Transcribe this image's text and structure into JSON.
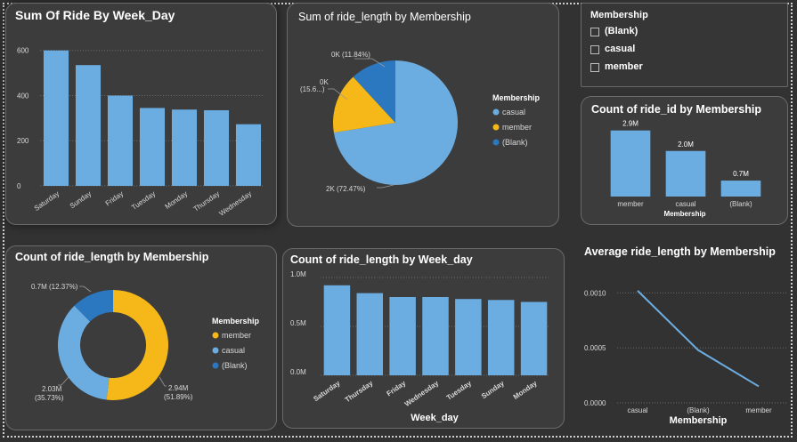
{
  "colors": {
    "background": "#323232",
    "card": "#3c3c3c",
    "light_blue": "#6cade1",
    "yellow": "#f6b818",
    "dark_blue": "#2b77c0",
    "grid": "#6a6a6a",
    "axis_text": "#d8d8d8"
  },
  "slicer": {
    "title": "Membership",
    "options": [
      "(Blank)",
      "casual",
      "member"
    ]
  },
  "chart_data": [
    {
      "id": "week_day_sum",
      "type": "bar",
      "title": "Sum Of Ride By Week_Day",
      "categories": [
        "Saturday",
        "Sunday",
        "Friday",
        "Tuesday",
        "Monday",
        "Thursday",
        "Wednesday"
      ],
      "values": [
        600,
        535,
        400,
        345,
        338,
        335,
        273
      ],
      "yticks": [
        "0",
        "200",
        "400",
        "600"
      ],
      "ytick_values": [
        0,
        200,
        400,
        600
      ],
      "ylim": [
        0,
        650
      ],
      "grid": true
    },
    {
      "id": "ride_length_sum_pie",
      "type": "pie",
      "title": "Sum of ride_length by Membership",
      "legend_title": "Membership",
      "legend_position": "right",
      "slices": [
        {
          "name": "casual",
          "value": 72.47,
          "label": "2K (72.47%)",
          "color": "#6cade1"
        },
        {
          "name": "member",
          "value": 15.69,
          "label": "0K (15.6...)",
          "color": "#f6b818"
        },
        {
          "name": "(Blank)",
          "value": 11.84,
          "label": "0K (11.84%)",
          "color": "#2b77c0"
        }
      ]
    },
    {
      "id": "ride_id_count",
      "type": "bar",
      "title": "Count of ride_id by Membership",
      "xlabel": "Membership",
      "categories": [
        "member",
        "casual",
        "(Blank)"
      ],
      "values": [
        2.9,
        2.0,
        0.7
      ],
      "data_labels": [
        "2.9M",
        "2.0M",
        "0.7M"
      ],
      "ylim": [
        0,
        3.2
      ]
    },
    {
      "id": "ride_length_count_donut",
      "type": "pie",
      "title": "Count of ride_length by Membership",
      "legend_title": "Membership",
      "legend_position": "right",
      "slices": [
        {
          "name": "member",
          "value": 51.89,
          "label_line1": "2.94M",
          "label_line2": "(51.89%)",
          "color": "#f6b818"
        },
        {
          "name": "casual",
          "value": 35.73,
          "label_line1": "2.03M",
          "label_line2": "(35.73%)",
          "color": "#6cade1"
        },
        {
          "name": "(Blank)",
          "value": 12.37,
          "label_line1": "0.7M (12.37%)",
          "label_line2": "",
          "color": "#2b77c0"
        }
      ]
    },
    {
      "id": "ride_length_count_weekday",
      "type": "bar",
      "title": "Count of ride_length by Week_day",
      "xlabel": "Week_day",
      "categories": [
        "Saturday",
        "Thursday",
        "Friday",
        "Wednesday",
        "Tuesday",
        "Sunday",
        "Monday"
      ],
      "values": [
        0.92,
        0.84,
        0.8,
        0.8,
        0.78,
        0.77,
        0.75
      ],
      "yticks": [
        "0.0M",
        "0.5M",
        "1.0M"
      ],
      "ytick_values": [
        0,
        0.5,
        1.0
      ],
      "ylim": [
        0,
        1.0
      ],
      "grid": true
    },
    {
      "id": "avg_ride_length",
      "type": "line",
      "title": "Average ride_length by Membership",
      "xlabel": "Membership",
      "categories": [
        "casual",
        "(Blank)",
        "member"
      ],
      "values": [
        0.00102,
        0.00048,
        0.00015
      ],
      "yticks": [
        "0.0000",
        "0.0005",
        "0.0010"
      ],
      "ytick_values": [
        0,
        0.0005,
        0.001
      ],
      "ylim": [
        0,
        0.0011
      ],
      "grid": true
    }
  ]
}
